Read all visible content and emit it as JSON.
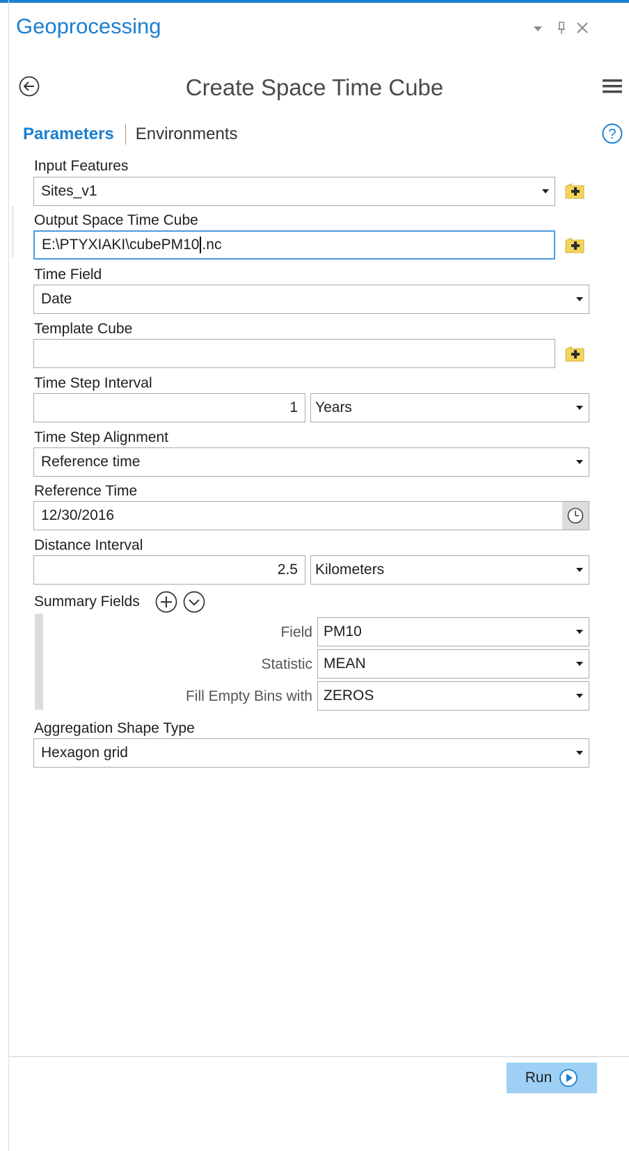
{
  "app": {
    "title": "Geoprocessing"
  },
  "tool": {
    "title": "Create Space Time Cube"
  },
  "tabs": [
    {
      "label": "Parameters",
      "active": true
    },
    {
      "label": "Environments",
      "active": false
    }
  ],
  "params": {
    "input_features": {
      "label": "Input Features",
      "value": "Sites_v1"
    },
    "output_cube": {
      "label": "Output Space Time Cube",
      "value_before_caret": "E:\\PTYXIAKI\\cubePM10",
      "value_after_caret": ".nc"
    },
    "time_field": {
      "label": "Time Field",
      "value": "Date"
    },
    "template_cube": {
      "label": "Template Cube",
      "value": ""
    },
    "time_step_interval": {
      "label": "Time Step Interval",
      "value": "1",
      "unit": "Years"
    },
    "time_step_alignment": {
      "label": "Time Step Alignment",
      "value": "Reference time"
    },
    "reference_time": {
      "label": "Reference Time",
      "value": "12/30/2016"
    },
    "distance_interval": {
      "label": "Distance Interval",
      "value": "2.5",
      "unit": "Kilometers"
    },
    "summary_fields": {
      "label": "Summary Fields",
      "field_label": "Field",
      "field_value": "PM10",
      "statistic_label": "Statistic",
      "statistic_value": "MEAN",
      "fill_label": "Fill Empty Bins with",
      "fill_value": "ZEROS"
    },
    "aggregation_shape": {
      "label": "Aggregation Shape Type",
      "value": "Hexagon grid"
    }
  },
  "footer": {
    "run_label": "Run"
  },
  "colors": {
    "accent": "#1b7fcf",
    "run_bg": "#9ed0f5",
    "folder": "#f2d45c"
  },
  "icons": {
    "back": "back-arrow-icon",
    "menu": "hamburger-menu-icon",
    "help": "help-icon",
    "browse": "folder-add-icon",
    "clock": "clock-icon",
    "add": "plus-circle-icon",
    "expand": "chevron-down-circle-icon",
    "run": "play-circle-icon",
    "window": [
      "dropdown-arrow-icon",
      "pin-icon",
      "close-icon"
    ]
  }
}
